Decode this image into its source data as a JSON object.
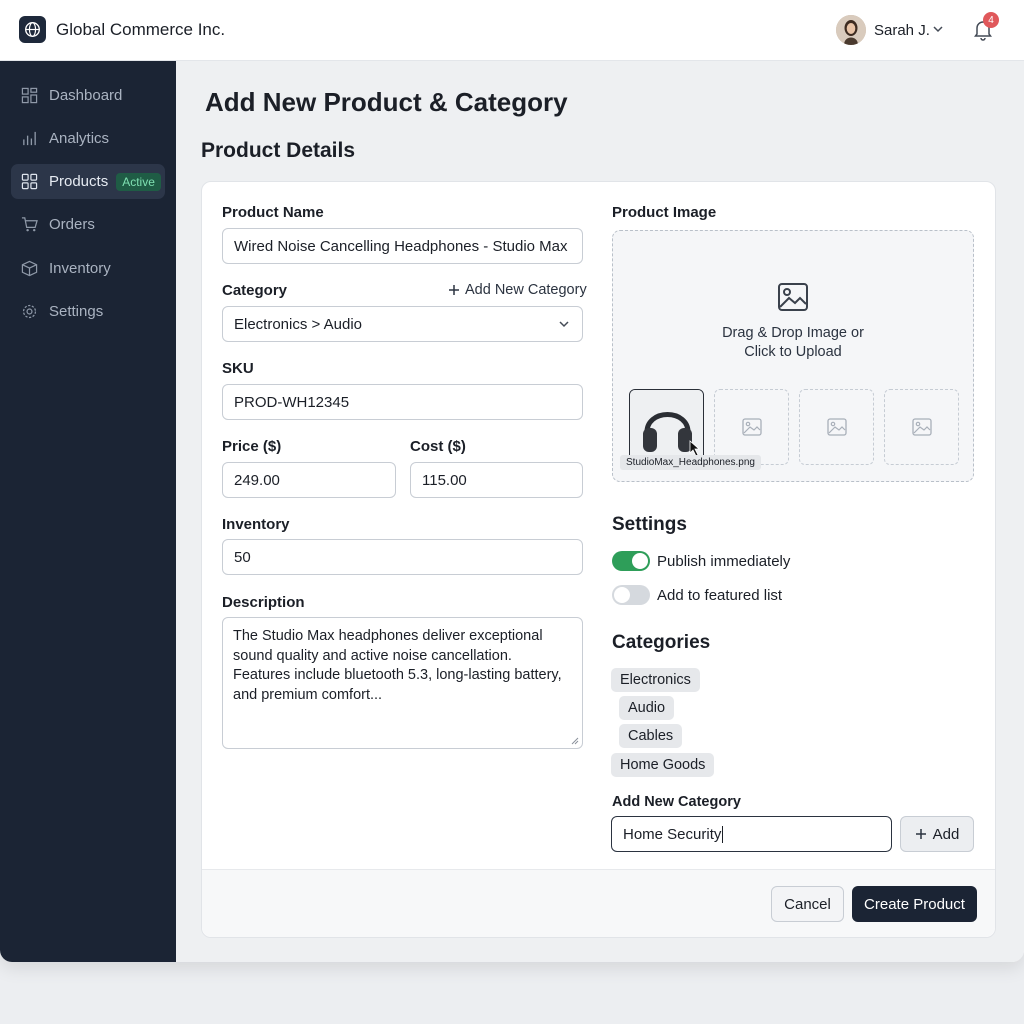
{
  "header": {
    "company": "Global Commerce Inc.",
    "user_name": "Sarah J.",
    "notification_count": "4"
  },
  "sidebar": {
    "items": [
      {
        "label": "Dashboard",
        "icon": "dashboard-icon"
      },
      {
        "label": "Analytics",
        "icon": "analytics-icon"
      },
      {
        "label": "Products",
        "icon": "products-icon",
        "badge": "Active"
      },
      {
        "label": "Orders",
        "icon": "cart-icon"
      },
      {
        "label": "Inventory",
        "icon": "box-icon"
      },
      {
        "label": "Settings",
        "icon": "gear-icon"
      }
    ]
  },
  "page": {
    "title": "Add New Product & Category",
    "section_title": "Product Details"
  },
  "form": {
    "product_name_label": "Product Name",
    "product_name_value": "Wired Noise Cancelling Headphones - Studio Max",
    "category_label": "Category",
    "add_category_link": "Add New Category",
    "category_value": "Electronics > Audio",
    "sku_label": "SKU",
    "sku_value": "PROD-WH12345",
    "price_label": "Price ($)",
    "price_value": "249.00",
    "cost_label": "Cost ($)",
    "cost_value": "115.00",
    "inventory_label": "Inventory",
    "inventory_value": "50",
    "description_label": "Description",
    "description_value": "The Studio Max headphones deliver exceptional sound quality and active noise cancellation. Features include bluetooth 5.3, long-lasting battery, and premium comfort..."
  },
  "image": {
    "label": "Product Image",
    "dropzone_line1": "Drag & Drop Image or",
    "dropzone_line2": "Click to Upload",
    "filename": "StudioMax_Headphones.png"
  },
  "settings": {
    "title": "Settings",
    "publish_label": "Publish immediately",
    "publish_on": true,
    "featured_label": "Add to featured list",
    "featured_on": false
  },
  "categories": {
    "title": "Categories",
    "items": [
      "Electronics",
      "Audio",
      "Cables",
      "Home Goods"
    ],
    "new_label": "Add New Category",
    "new_value": "Home Security",
    "add_button": "Add"
  },
  "actions": {
    "cancel": "Cancel",
    "create": "Create Product"
  },
  "colors": {
    "sidebar_bg": "#1b2434",
    "toggle_on": "#2e9e59",
    "badge_red": "#e0585b",
    "primary_button": "#1b2434"
  }
}
